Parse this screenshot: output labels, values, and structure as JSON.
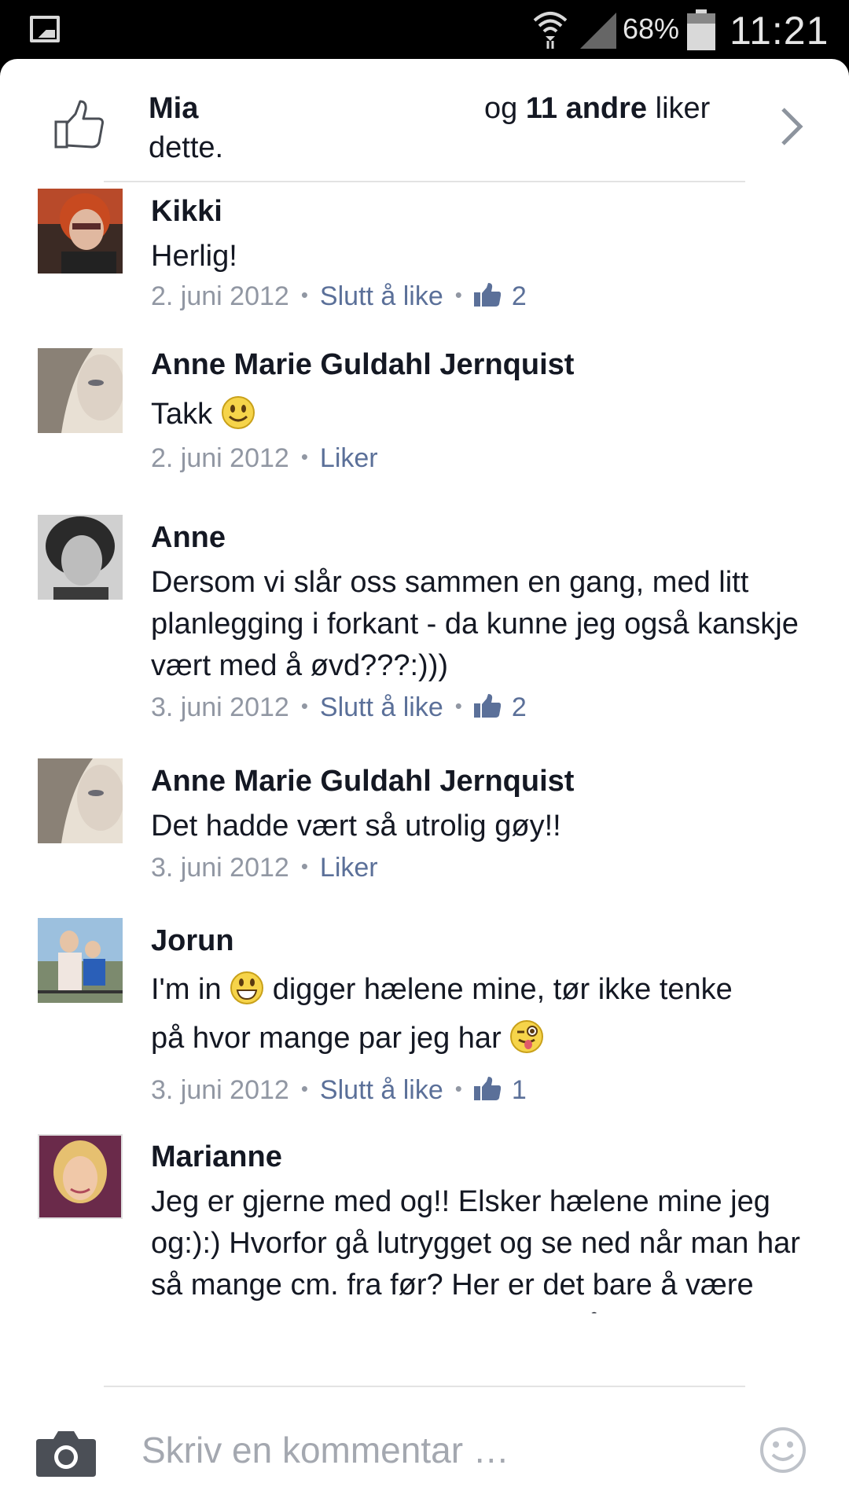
{
  "status_bar": {
    "battery_percent": "68%",
    "time": "11:21",
    "icons": [
      "gallery-icon",
      "wifi-icon",
      "signal-icon",
      "battery-icon"
    ]
  },
  "likes": {
    "name": "Mia",
    "and": "og",
    "others": "11 andre",
    "verb": "liker",
    "suffix": "dette."
  },
  "comments": [
    {
      "name": "Kikki",
      "text": "Herlig!",
      "date": "2. juni 2012",
      "action": "Slutt å like",
      "likes": "2"
    },
    {
      "name": "Anne Marie Guldahl Jernquist",
      "text": "Takk",
      "date": "2. juni 2012",
      "action": "Liker"
    },
    {
      "name": "Anne",
      "text": "Dersom vi slår oss sammen en gang, med litt planlegging i forkant - da kunne jeg også kanskje vært med å øvd???:)))",
      "date": "3. juni 2012",
      "action": "Slutt å like",
      "likes": "2"
    },
    {
      "name": "Anne Marie Guldahl Jernquist",
      "text": "Det hadde vært så utrolig gøy!!",
      "date": "3. juni 2012",
      "action": "Liker"
    },
    {
      "name": "Jorun",
      "text_part1": "I'm in",
      "text_part2": "digger hælene mine, tør ikke tenke",
      "text_part3": "på hvor mange par jeg har",
      "date": "3. juni 2012",
      "action": "Slutt å like",
      "likes": "1"
    },
    {
      "name": "Marianne",
      "text": "Jeg er gjerne med og!! Elsker hælene mine jeg og:):) Hvorfor gå lutrygget og se ned når man har så mange cm. fra før? Her er det bare å være stolt, rette opp skuldrene, og ta på hælene:):)"
    }
  ],
  "composer": {
    "placeholder": "Skriv en kommentar …"
  },
  "colors": {
    "link": "#5b7099",
    "meta": "#9197a3",
    "text": "#141823"
  }
}
